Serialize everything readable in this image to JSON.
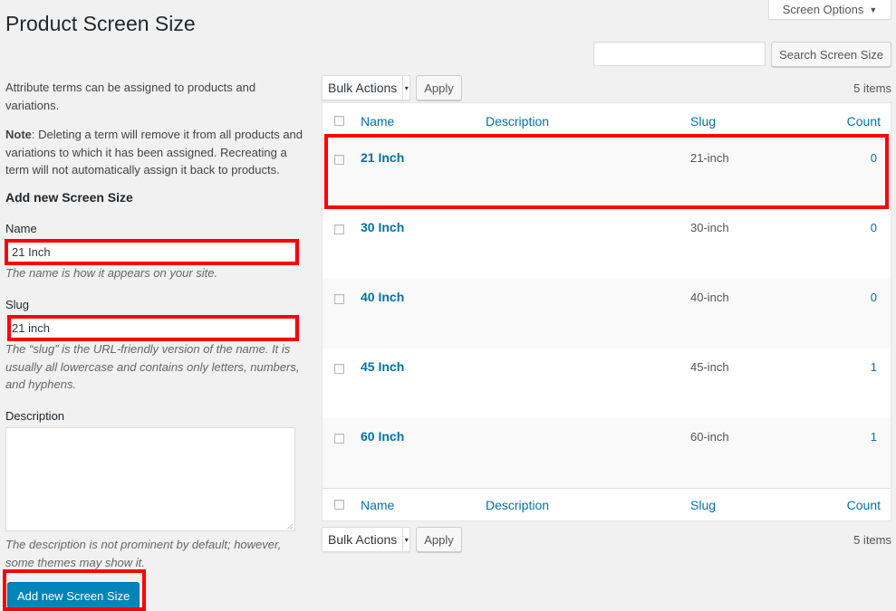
{
  "header": {
    "screen_options": "Screen Options",
    "title": "Product Screen Size",
    "search_button": "Search Screen Size",
    "search_value": ""
  },
  "left": {
    "intro": "Attribute terms can be assigned to products and variations.",
    "note_bold": "Note",
    "note_text": ": Deleting a term will remove it from all products and variations to which it has been assigned. Recreating a term will not automatically assign it back to products.",
    "heading": "Add new Screen Size",
    "name_label": "Name",
    "name_value": "21 Inch",
    "name_hint": "The name is how it appears on your site.",
    "slug_label": "Slug",
    "slug_value": "21 inch",
    "slug_hint": "The “slug” is the URL-friendly version of the name. It is usually all lowercase and contains only letters, numbers, and hyphens.",
    "description_label": "Description",
    "description_hint": "The description is not prominent by default; however, some themes may show it.",
    "submit": "Add new Screen Size"
  },
  "table": {
    "bulk_actions": "Bulk Actions",
    "apply": "Apply",
    "items_count": "5 items",
    "columns": {
      "name": "Name",
      "description": "Description",
      "slug": "Slug",
      "count": "Count"
    },
    "rows": [
      {
        "name": "21 Inch",
        "slug": "21-inch",
        "count": "0"
      },
      {
        "name": "30 Inch",
        "slug": "30-inch",
        "count": "0"
      },
      {
        "name": "40 Inch",
        "slug": "40-inch",
        "count": "0"
      },
      {
        "name": "45 Inch",
        "slug": "45-inch",
        "count": "1"
      },
      {
        "name": "60 Inch",
        "slug": "60-inch",
        "count": "1"
      }
    ]
  },
  "colors": {
    "accent": "#0073aa",
    "primary_button": "#0085ba",
    "highlight": "#ff0000"
  }
}
